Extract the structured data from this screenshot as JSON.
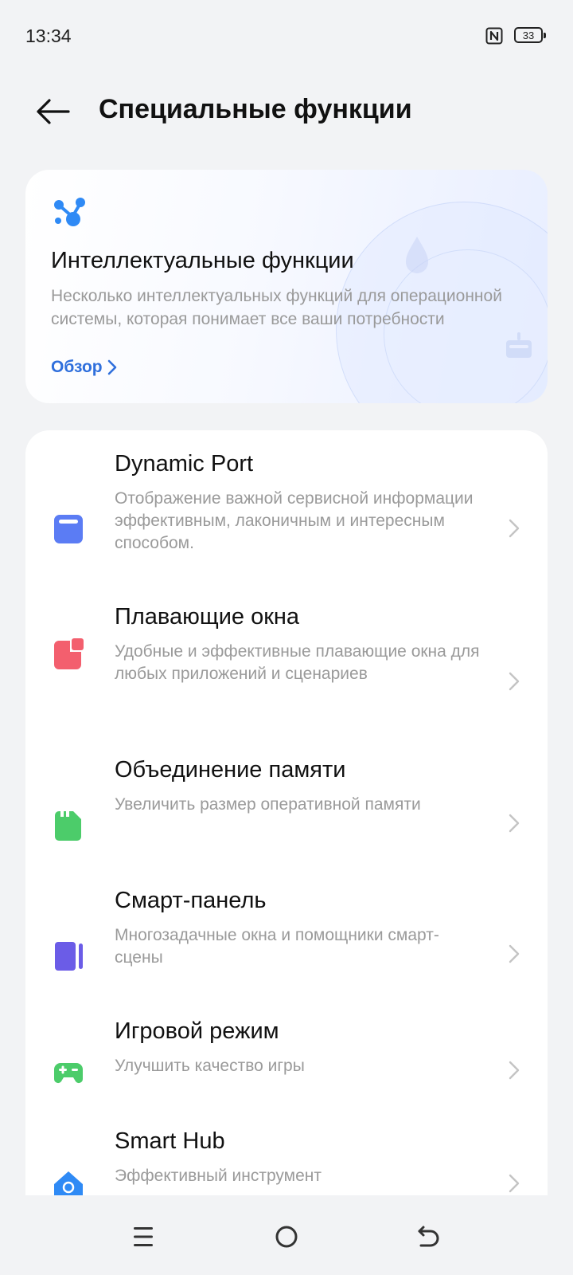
{
  "status_bar": {
    "time": "13:34",
    "battery": "33"
  },
  "header": {
    "title": "Специальные функции"
  },
  "feature_card": {
    "title": "Интеллектуальные функции",
    "description": "Несколько интеллектуальных функций для операционной системы, которая понимает все ваши потребности",
    "link_label": "Обзор"
  },
  "items": [
    {
      "title": "Dynamic Port",
      "description": "Отображение важной сервисной информации эффективным, лаконичным и интересным способом.",
      "icon": "window-icon",
      "color": "#5b7cf4"
    },
    {
      "title": "Плавающие окна",
      "description": "Удобные и эффективные плавающие окна для любых приложений и сценариев",
      "icon": "floating-window-icon",
      "color": "#f35f6e"
    },
    {
      "title": "Объединение памяти",
      "description": "Увеличить размер оперативной памяти",
      "icon": "memory-card-icon",
      "color": "#4ccc6a"
    },
    {
      "title": "Смарт-панель",
      "description": "Многозадачные окна и помощники смарт-сцены",
      "icon": "sidebar-panel-icon",
      "color": "#6b5ce7"
    },
    {
      "title": "Игровой режим",
      "description": "Улучшить качество игры",
      "icon": "gamepad-icon",
      "color": "#4ccc6a"
    },
    {
      "title": "Smart Hub",
      "description": "Эффективный инструмент",
      "icon": "smart-hub-icon",
      "color": "#2f8af5"
    }
  ],
  "colors": {
    "accent": "#2f6fdc",
    "background": "#f2f3f5",
    "secondary_text": "#9a9a9a"
  }
}
